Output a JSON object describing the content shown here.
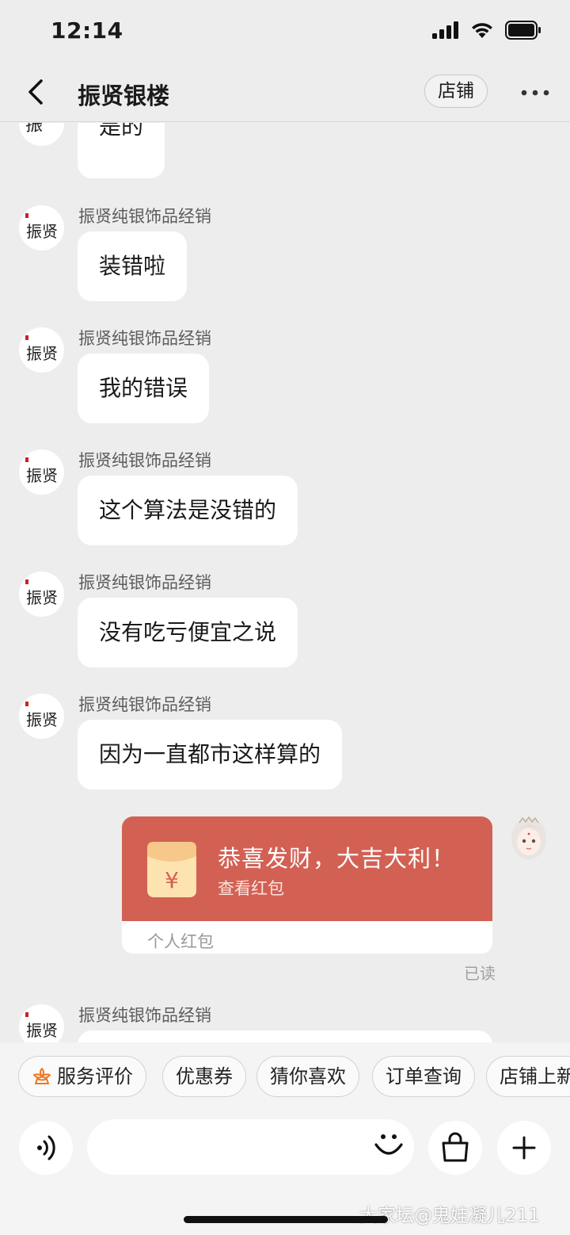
{
  "status_bar": {
    "time": "12:14"
  },
  "header": {
    "title": "振贤银楼",
    "shop_label": "店铺"
  },
  "messages": [
    {
      "sender": "",
      "text": "是的"
    },
    {
      "sender": "振贤纯银饰品经销",
      "text": "装错啦"
    },
    {
      "sender": "振贤纯银饰品经销",
      "text": "我的错误"
    },
    {
      "sender": "振贤纯银饰品经销",
      "text": "这个算法是没错的"
    },
    {
      "sender": "振贤纯银饰品经销",
      "text": "没有吃亏便宜之说"
    },
    {
      "sender": "振贤纯银饰品经销",
      "text": "因为一直都市这样算的"
    },
    {
      "sender": "振贤纯银饰品经销",
      "text": ""
    }
  ],
  "red_packet": {
    "title": "恭喜发财，大吉大利！",
    "subtitle": "查看红包",
    "footer": "个人红包",
    "status": "已读",
    "color": "#d26154"
  },
  "quick_chips": [
    "服务评价",
    "优惠券",
    "猜你喜欢",
    "订单查询",
    "店铺上新"
  ],
  "input": {
    "placeholder": ""
  },
  "watermark": "大家坛@鬼娃凝儿211"
}
